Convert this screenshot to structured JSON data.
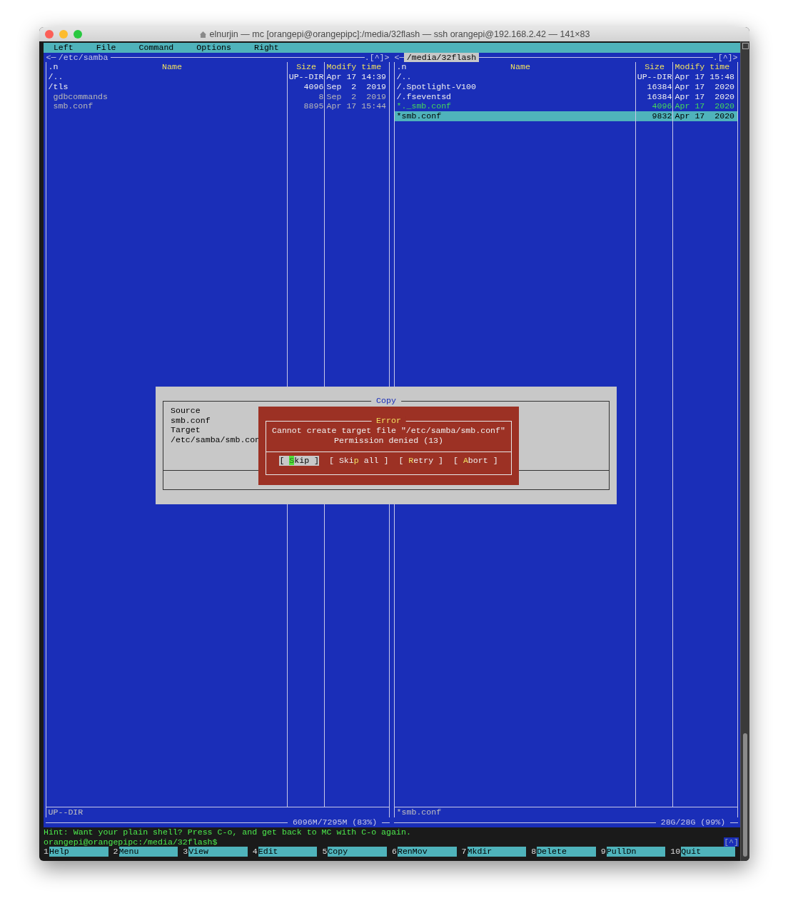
{
  "window": {
    "title": "elnurjin — mc [orangepi@orangepipc]:/media/32flash — ssh orangepi@192.168.2.42 — 141×83"
  },
  "menu_bar": [
    "Left",
    "File",
    "Command",
    "Options",
    "Right"
  ],
  "panels": [
    {
      "active": false,
      "corner_left": "<─",
      "path": "/etc/samba",
      "corner_right": ".[^]>",
      "header": {
        "sort": ".n",
        "name": "Name",
        "size": "Size",
        "time": "Modify time"
      },
      "rows": [
        {
          "kind": "dir",
          "name": "/..",
          "size": "UP--DIR",
          "time": "Apr 17 14:39",
          "selected": false
        },
        {
          "kind": "dir",
          "name": "/tls",
          "size": "4096",
          "time": "Sep  2  2019",
          "selected": false
        },
        {
          "kind": "file",
          "name": "gdbcommands",
          "size": "8",
          "time": "Sep  2  2019",
          "selected": false
        },
        {
          "kind": "file",
          "name": "smb.conf",
          "size": "8895",
          "time": "Apr 17 15:44",
          "selected": false
        }
      ],
      "status": "UP--DIR",
      "disk": "6096M/7295M (83%)"
    },
    {
      "active": true,
      "corner_left": "<─",
      "path": "/media/32flash",
      "corner_right": ".[^]>",
      "header": {
        "sort": ".n",
        "name": "Name",
        "size": "Size",
        "time": "Modify time"
      },
      "rows": [
        {
          "kind": "dir",
          "name": "/..",
          "size": "UP--DIR",
          "time": "Apr 17 15:48",
          "selected": false
        },
        {
          "kind": "dir",
          "name": "/.Spotlight-V100",
          "size": "16384",
          "time": "Apr 17  2020",
          "selected": false
        },
        {
          "kind": "dir",
          "name": "/.fseventsd",
          "size": "16384",
          "time": "Apr 17  2020",
          "selected": false
        },
        {
          "kind": "exec",
          "name": "*._smb.conf",
          "size": "4096",
          "time": "Apr 17  2020",
          "selected": false
        },
        {
          "kind": "exec",
          "name": "*smb.conf",
          "size": "9832",
          "time": "Apr 17  2020",
          "selected": true
        }
      ],
      "status": "*smb.conf",
      "disk": "28G/28G (99%)"
    }
  ],
  "copy_dialog": {
    "title": "Copy",
    "lines": [
      "Source",
      "smb.conf",
      "Target",
      "/etc/samba/smb.con"
    ]
  },
  "error_dialog": {
    "title": "Error",
    "message": [
      "Cannot create target file \"/etc/samba/smb.conf\"",
      "Permission denied (13)"
    ],
    "buttons": [
      {
        "before": "[ ",
        "hotkey": "S",
        "after": "kip ]",
        "selected": true
      },
      {
        "before": "[ Ski",
        "hotkey": "p",
        "after": " all ]",
        "selected": false
      },
      {
        "before": "[ ",
        "hotkey": "R",
        "after": "etry ]",
        "selected": false
      },
      {
        "before": "[ ",
        "hotkey": "A",
        "after": "bort ]",
        "selected": false
      }
    ]
  },
  "hint": "Hint: Want your plain shell? Press C-o, and get back to MC with C-o again.",
  "prompt": "orangepi@orangepipc:/media/32flash$",
  "prompt_corner": "[^]",
  "function_keys": [
    {
      "number": "1",
      "label": "Help"
    },
    {
      "number": "2",
      "label": "Menu"
    },
    {
      "number": "3",
      "label": "View"
    },
    {
      "number": "4",
      "label": "Edit"
    },
    {
      "number": "5",
      "label": "Copy"
    },
    {
      "number": "6",
      "label": "RenMov"
    },
    {
      "number": "7",
      "label": "Mkdir"
    },
    {
      "number": "8",
      "label": "Delete"
    },
    {
      "number": "9",
      "label": "PullDn"
    },
    {
      "number": "10",
      "label": "Quit"
    }
  ]
}
